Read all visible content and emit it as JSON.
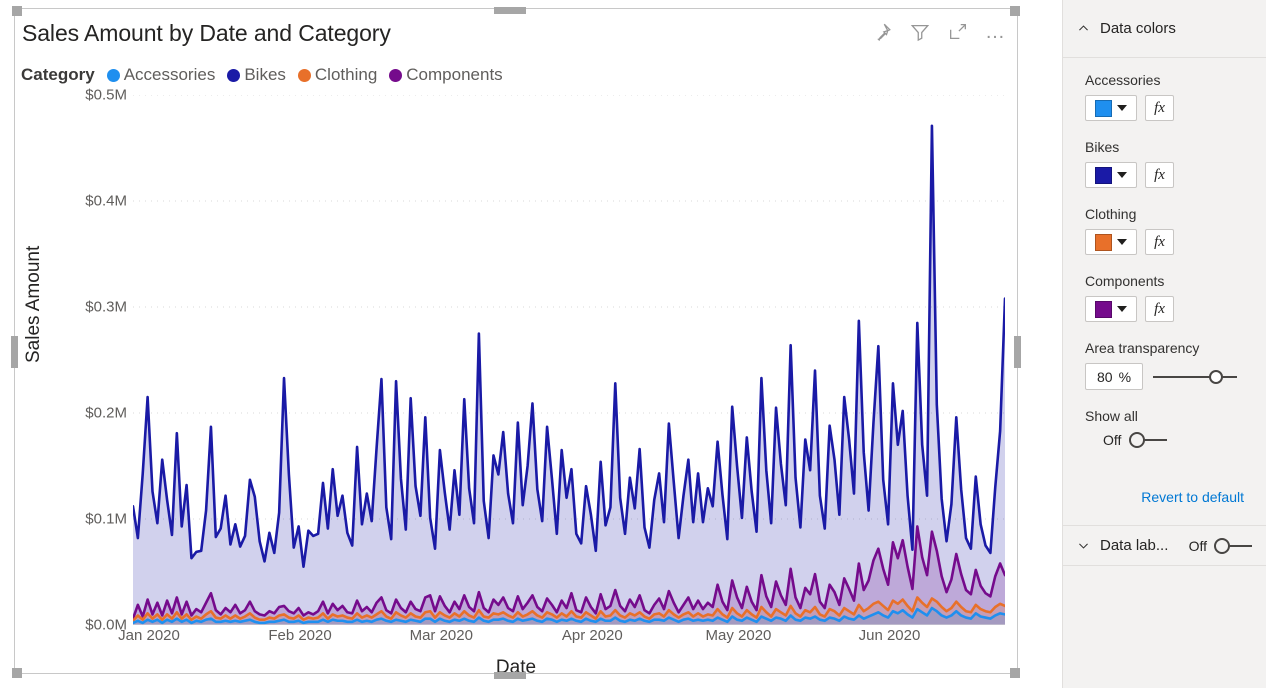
{
  "visual": {
    "title": "Sales Amount by Date and Category",
    "header_icons": [
      {
        "name": "pin-icon",
        "label": "Pin to dashboard"
      },
      {
        "name": "filter-icon",
        "label": "Filters"
      },
      {
        "name": "focus-mode-icon",
        "label": "Focus mode"
      },
      {
        "name": "more-options-icon",
        "label": "More options"
      }
    ],
    "legend": {
      "title": "Category",
      "items": [
        {
          "label": "Accessories",
          "color": "#1F8FEF"
        },
        {
          "label": "Bikes",
          "color": "#1A1AA6"
        },
        {
          "label": "Clothing",
          "color": "#E8702A"
        },
        {
          "label": "Components",
          "color": "#750B8C"
        }
      ]
    }
  },
  "chart_data": {
    "type": "area",
    "title": "Sales Amount by Date and Category",
    "xlabel": "Date",
    "ylabel": "Sales Amount",
    "ylim": [
      0,
      0.5
    ],
    "ytick_labels": [
      "$0.0M",
      "$0.1M",
      "$0.2M",
      "$0.3M",
      "$0.4M",
      "$0.5M"
    ],
    "ytick_values": [
      0,
      0.1,
      0.2,
      0.3,
      0.4,
      0.5
    ],
    "xtick_labels": [
      "Jan 2020",
      "Feb 2020",
      "Mar 2020",
      "Apr 2020",
      "May 2020",
      "Jun 2020"
    ],
    "xtick_positions": [
      0,
      31,
      60,
      91,
      121,
      152
    ],
    "x_range": [
      0,
      180
    ],
    "grid": true,
    "legend_position": "top",
    "area_transparency_pct": 80,
    "units": "millions of dollars",
    "series": [
      {
        "name": "Bikes",
        "color": "#1A1AA6",
        "values": [
          0.112,
          0.082,
          0.143,
          0.215,
          0.126,
          0.096,
          0.156,
          0.118,
          0.085,
          0.181,
          0.093,
          0.132,
          0.063,
          0.069,
          0.07,
          0.108,
          0.187,
          0.083,
          0.091,
          0.122,
          0.076,
          0.095,
          0.074,
          0.084,
          0.137,
          0.121,
          0.079,
          0.06,
          0.087,
          0.068,
          0.106,
          0.233,
          0.142,
          0.073,
          0.093,
          0.055,
          0.089,
          0.084,
          0.086,
          0.134,
          0.091,
          0.147,
          0.103,
          0.122,
          0.087,
          0.075,
          0.168,
          0.095,
          0.124,
          0.098,
          0.167,
          0.232,
          0.111,
          0.081,
          0.23,
          0.138,
          0.09,
          0.214,
          0.131,
          0.103,
          0.196,
          0.101,
          0.072,
          0.165,
          0.125,
          0.09,
          0.146,
          0.104,
          0.213,
          0.129,
          0.096,
          0.275,
          0.117,
          0.082,
          0.16,
          0.142,
          0.182,
          0.124,
          0.096,
          0.191,
          0.113,
          0.15,
          0.209,
          0.128,
          0.098,
          0.187,
          0.138,
          0.086,
          0.165,
          0.12,
          0.147,
          0.086,
          0.077,
          0.131,
          0.104,
          0.07,
          0.154,
          0.094,
          0.111,
          0.228,
          0.12,
          0.086,
          0.139,
          0.11,
          0.166,
          0.092,
          0.073,
          0.118,
          0.143,
          0.097,
          0.19,
          0.135,
          0.082,
          0.122,
          0.156,
          0.097,
          0.143,
          0.097,
          0.129,
          0.112,
          0.173,
          0.123,
          0.081,
          0.206,
          0.15,
          0.101,
          0.177,
          0.126,
          0.088,
          0.233,
          0.146,
          0.096,
          0.205,
          0.152,
          0.113,
          0.264,
          0.139,
          0.092,
          0.175,
          0.146,
          0.24,
          0.122,
          0.091,
          0.188,
          0.156,
          0.104,
          0.215,
          0.175,
          0.124,
          0.287,
          0.163,
          0.108,
          0.191,
          0.263,
          0.137,
          0.095,
          0.228,
          0.17,
          0.202,
          0.122,
          0.071,
          0.285,
          0.17,
          0.122,
          0.471,
          0.208,
          0.119,
          0.079,
          0.114,
          0.196,
          0.128,
          0.082,
          0.072,
          0.14,
          0.095,
          0.075,
          0.068,
          0.13,
          0.183,
          0.308
        ]
      },
      {
        "name": "Components",
        "color": "#750B8C",
        "values": [
          0.006,
          0.019,
          0.008,
          0.024,
          0.01,
          0.021,
          0.009,
          0.023,
          0.011,
          0.026,
          0.01,
          0.022,
          0.009,
          0.015,
          0.012,
          0.021,
          0.03,
          0.014,
          0.01,
          0.016,
          0.012,
          0.019,
          0.011,
          0.014,
          0.022,
          0.013,
          0.01,
          0.009,
          0.013,
          0.011,
          0.017,
          0.018,
          0.013,
          0.011,
          0.016,
          0.009,
          0.012,
          0.01,
          0.013,
          0.022,
          0.011,
          0.02,
          0.014,
          0.018,
          0.012,
          0.011,
          0.023,
          0.013,
          0.017,
          0.012,
          0.021,
          0.026,
          0.014,
          0.011,
          0.024,
          0.016,
          0.012,
          0.022,
          0.015,
          0.013,
          0.026,
          0.028,
          0.013,
          0.027,
          0.018,
          0.012,
          0.022,
          0.015,
          0.028,
          0.017,
          0.013,
          0.031,
          0.016,
          0.012,
          0.024,
          0.019,
          0.026,
          0.016,
          0.013,
          0.027,
          0.015,
          0.021,
          0.028,
          0.017,
          0.013,
          0.025,
          0.019,
          0.012,
          0.023,
          0.016,
          0.03,
          0.014,
          0.012,
          0.026,
          0.017,
          0.011,
          0.029,
          0.015,
          0.018,
          0.033,
          0.018,
          0.013,
          0.024,
          0.017,
          0.028,
          0.014,
          0.011,
          0.019,
          0.025,
          0.015,
          0.032,
          0.021,
          0.012,
          0.019,
          0.026,
          0.015,
          0.023,
          0.015,
          0.021,
          0.017,
          0.038,
          0.022,
          0.014,
          0.042,
          0.026,
          0.016,
          0.036,
          0.022,
          0.014,
          0.047,
          0.027,
          0.017,
          0.041,
          0.028,
          0.019,
          0.053,
          0.026,
          0.016,
          0.035,
          0.029,
          0.048,
          0.022,
          0.016,
          0.038,
          0.031,
          0.019,
          0.044,
          0.034,
          0.023,
          0.058,
          0.033,
          0.042,
          0.061,
          0.072,
          0.053,
          0.038,
          0.078,
          0.063,
          0.08,
          0.055,
          0.034,
          0.093,
          0.064,
          0.047,
          0.088,
          0.07,
          0.046,
          0.031,
          0.043,
          0.067,
          0.048,
          0.033,
          0.029,
          0.052,
          0.037,
          0.03,
          0.027,
          0.046,
          0.058,
          0.047
        ]
      },
      {
        "name": "Clothing",
        "color": "#E8702A",
        "values": [
          0.004,
          0.009,
          0.005,
          0.011,
          0.006,
          0.01,
          0.005,
          0.01,
          0.006,
          0.012,
          0.006,
          0.01,
          0.005,
          0.008,
          0.006,
          0.01,
          0.013,
          0.007,
          0.006,
          0.009,
          0.006,
          0.009,
          0.006,
          0.008,
          0.011,
          0.007,
          0.005,
          0.005,
          0.007,
          0.006,
          0.009,
          0.01,
          0.007,
          0.006,
          0.009,
          0.005,
          0.007,
          0.006,
          0.007,
          0.011,
          0.006,
          0.01,
          0.008,
          0.009,
          0.007,
          0.006,
          0.011,
          0.007,
          0.009,
          0.007,
          0.01,
          0.013,
          0.008,
          0.006,
          0.012,
          0.009,
          0.007,
          0.011,
          0.008,
          0.007,
          0.012,
          0.013,
          0.007,
          0.012,
          0.009,
          0.007,
          0.011,
          0.008,
          0.013,
          0.009,
          0.007,
          0.014,
          0.008,
          0.007,
          0.011,
          0.01,
          0.012,
          0.009,
          0.007,
          0.012,
          0.008,
          0.01,
          0.013,
          0.009,
          0.007,
          0.012,
          0.01,
          0.007,
          0.011,
          0.008,
          0.013,
          0.008,
          0.007,
          0.012,
          0.009,
          0.006,
          0.013,
          0.008,
          0.009,
          0.014,
          0.009,
          0.007,
          0.011,
          0.009,
          0.012,
          0.008,
          0.006,
          0.01,
          0.011,
          0.008,
          0.014,
          0.01,
          0.007,
          0.01,
          0.012,
          0.008,
          0.011,
          0.008,
          0.01,
          0.009,
          0.015,
          0.01,
          0.007,
          0.016,
          0.011,
          0.008,
          0.014,
          0.01,
          0.007,
          0.017,
          0.012,
          0.008,
          0.015,
          0.012,
          0.009,
          0.018,
          0.011,
          0.008,
          0.014,
          0.012,
          0.017,
          0.01,
          0.008,
          0.015,
          0.013,
          0.009,
          0.016,
          0.013,
          0.01,
          0.019,
          0.013,
          0.016,
          0.02,
          0.022,
          0.018,
          0.014,
          0.023,
          0.02,
          0.024,
          0.018,
          0.013,
          0.026,
          0.021,
          0.017,
          0.025,
          0.022,
          0.017,
          0.013,
          0.016,
          0.022,
          0.017,
          0.013,
          0.012,
          0.019,
          0.015,
          0.013,
          0.012,
          0.017,
          0.02,
          0.018
        ]
      },
      {
        "name": "Accessories",
        "color": "#1F8FEF",
        "values": [
          0.002,
          0.004,
          0.002,
          0.005,
          0.003,
          0.005,
          0.002,
          0.005,
          0.003,
          0.006,
          0.003,
          0.005,
          0.002,
          0.004,
          0.003,
          0.005,
          0.006,
          0.003,
          0.003,
          0.004,
          0.003,
          0.004,
          0.003,
          0.004,
          0.005,
          0.003,
          0.002,
          0.002,
          0.003,
          0.003,
          0.004,
          0.005,
          0.003,
          0.003,
          0.004,
          0.002,
          0.003,
          0.003,
          0.003,
          0.005,
          0.003,
          0.005,
          0.004,
          0.004,
          0.003,
          0.003,
          0.005,
          0.003,
          0.004,
          0.003,
          0.005,
          0.006,
          0.004,
          0.003,
          0.005,
          0.004,
          0.003,
          0.005,
          0.004,
          0.003,
          0.006,
          0.006,
          0.003,
          0.006,
          0.004,
          0.003,
          0.005,
          0.004,
          0.006,
          0.004,
          0.003,
          0.007,
          0.004,
          0.003,
          0.005,
          0.005,
          0.006,
          0.004,
          0.003,
          0.006,
          0.004,
          0.005,
          0.006,
          0.004,
          0.003,
          0.006,
          0.005,
          0.003,
          0.005,
          0.004,
          0.006,
          0.004,
          0.003,
          0.006,
          0.004,
          0.003,
          0.006,
          0.004,
          0.004,
          0.007,
          0.004,
          0.003,
          0.005,
          0.004,
          0.006,
          0.004,
          0.003,
          0.005,
          0.005,
          0.004,
          0.007,
          0.005,
          0.003,
          0.005,
          0.006,
          0.004,
          0.005,
          0.004,
          0.005,
          0.004,
          0.007,
          0.005,
          0.003,
          0.008,
          0.005,
          0.004,
          0.007,
          0.005,
          0.003,
          0.008,
          0.006,
          0.004,
          0.007,
          0.006,
          0.004,
          0.009,
          0.005,
          0.004,
          0.007,
          0.006,
          0.008,
          0.005,
          0.004,
          0.007,
          0.006,
          0.004,
          0.008,
          0.006,
          0.005,
          0.009,
          0.006,
          0.008,
          0.01,
          0.012,
          0.009,
          0.007,
          0.013,
          0.011,
          0.014,
          0.01,
          0.007,
          0.015,
          0.012,
          0.009,
          0.016,
          0.013,
          0.009,
          0.007,
          0.009,
          0.013,
          0.009,
          0.007,
          0.006,
          0.011,
          0.008,
          0.007,
          0.006,
          0.009,
          0.011,
          0.01
        ]
      }
    ]
  },
  "panel": {
    "data_colors": {
      "section_title": "Data colors",
      "expanded": true,
      "fields": [
        {
          "label": "Accessories",
          "color": "#1F8FEF",
          "fx_label": "fx"
        },
        {
          "label": "Bikes",
          "color": "#1A1AA6",
          "fx_label": "fx"
        },
        {
          "label": "Clothing",
          "color": "#E8702A",
          "fx_label": "fx"
        },
        {
          "label": "Components",
          "color": "#750B8C",
          "fx_label": "fx"
        }
      ],
      "area_transparency": {
        "label": "Area transparency",
        "value": "80",
        "unit": "%",
        "slider_pct": 80
      },
      "show_all": {
        "label": "Show all",
        "state": "Off"
      },
      "revert_label": "Revert to default"
    },
    "data_labels": {
      "section_title": "Data lab...",
      "state": "Off",
      "expanded": false
    }
  }
}
